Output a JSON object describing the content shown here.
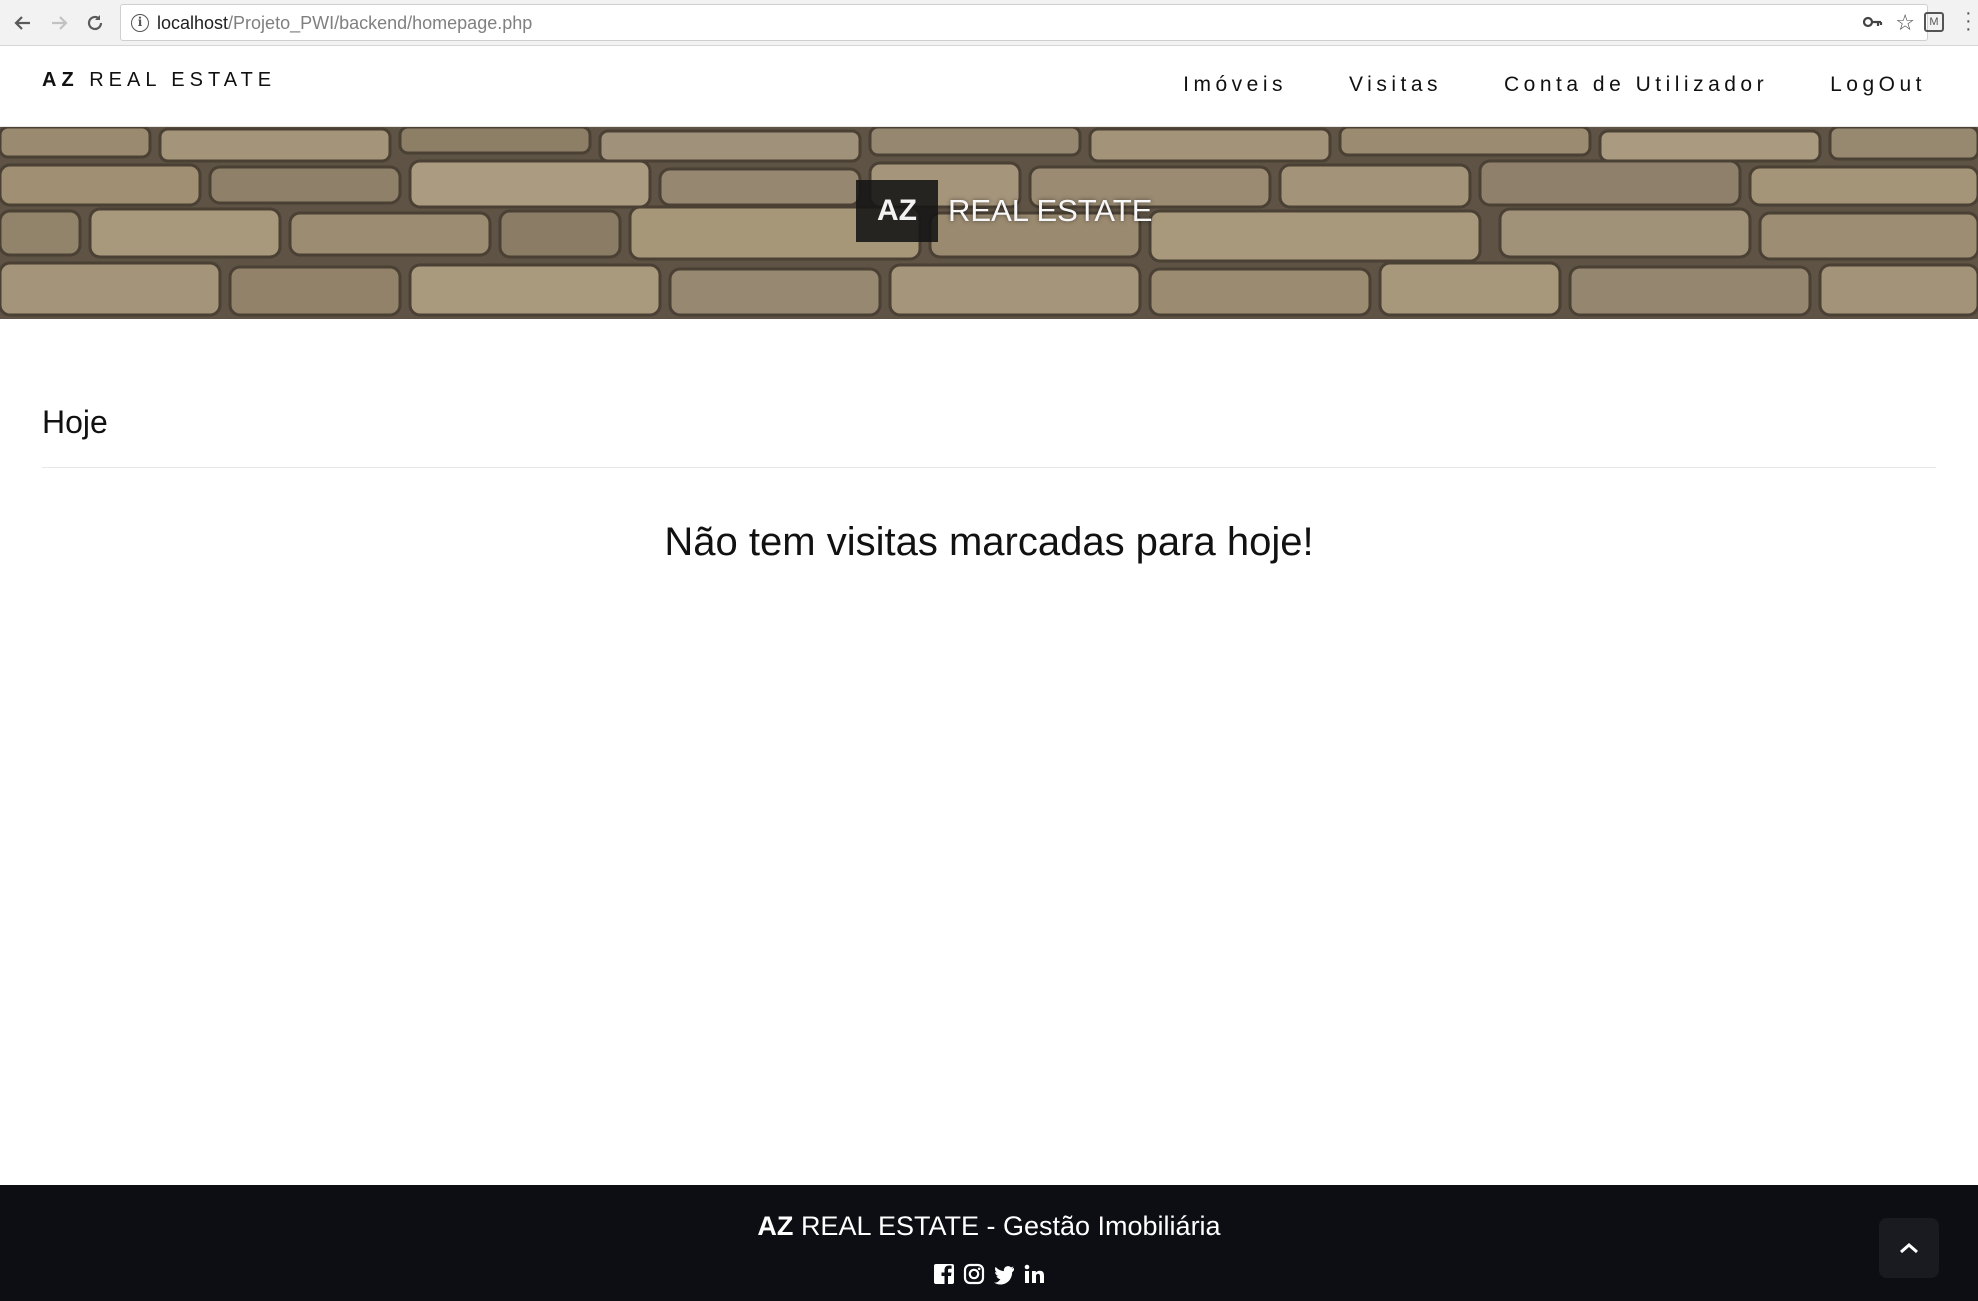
{
  "browser": {
    "url_host": "localhost",
    "url_path": "/Projeto_PWI/backend/homepage.php"
  },
  "navbar": {
    "brand_bold": "AZ",
    "brand_rest": "REAL ESTATE",
    "items": [
      {
        "label": "Imóveis"
      },
      {
        "label": "Visitas"
      },
      {
        "label": "Conta de Utilizador"
      },
      {
        "label": "LogOut"
      }
    ]
  },
  "hero": {
    "badge": "AZ",
    "text": "REAL ESTATE"
  },
  "main": {
    "section_title": "Hoje",
    "empty_message": "Não tem visitas marcadas para hoje!"
  },
  "footer": {
    "brand_bold": "AZ",
    "brand_rest": "REAL ESTATE - Gestão Imobiliária",
    "socials": [
      "facebook-icon",
      "instagram-icon",
      "twitter-icon",
      "linkedin-icon"
    ]
  },
  "colors": {
    "footer_bg": "#0d0e14",
    "hero_badge_bg": "#141414"
  }
}
